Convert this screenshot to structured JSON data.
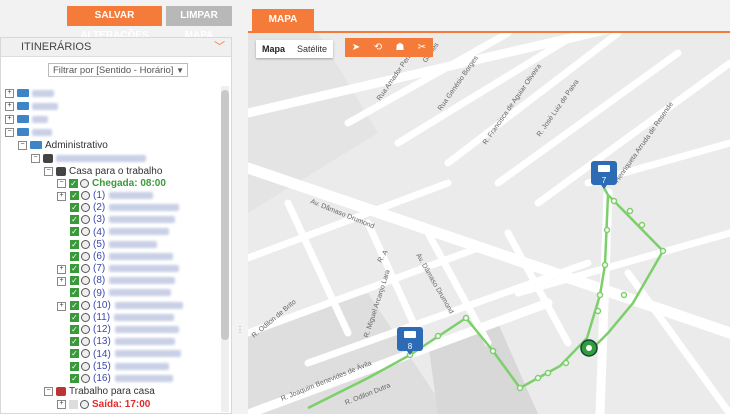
{
  "toolbar": {
    "save_label": "SALVAR ALTERAÇÕES",
    "clear_label": "LIMPAR MAPA"
  },
  "left": {
    "title": "ITINERÁRIOS",
    "filter_value": "Filtrar por [Sentido - Horário]"
  },
  "tree": {
    "admin": "Administrativo",
    "casa": "Casa para o trabalho",
    "chegada": "Chegada: 08:00",
    "trabalho": "Trabalho para casa",
    "saida": "Saída: 17:00",
    "stops": [
      "(1)",
      "(2)",
      "(3)",
      "(4)",
      "(5)",
      "(6)",
      "(7)",
      "(8)",
      "(9)",
      "(10)",
      "(11)",
      "(12)",
      "(13)",
      "(14)",
      "(15)",
      "(16)"
    ]
  },
  "map": {
    "tab_label": "MAPA",
    "type_map": "Mapa",
    "type_satellite": "Satélite",
    "tools": [
      "locate-icon",
      "route-icon",
      "people-icon",
      "scissors-icon"
    ],
    "streets": [
      "Rua Amador Pena",
      "Rua Genésio Borges",
      "R. Francisca de Aguiar Oliveira",
      "R. José Luiz de Paiva",
      "Henriqueta Arruda de Resende",
      "Av. Dâmaso Drumond",
      "Av. Dâmaso Drumond",
      "R. A",
      "R. Miguel Arcanjo Lara",
      "R. Odilon de Brito",
      "R. Joaquim Benevides de Ávila",
      "R. Odilon Dutra",
      "Gomes"
    ],
    "bus_labels": [
      "7",
      "8"
    ]
  },
  "colors": {
    "accent": "#f47b3a",
    "route": "#7ccf6a",
    "check": "#3a9a3a",
    "arrival": "#3a9a3a",
    "departure": "#e02b2b"
  }
}
